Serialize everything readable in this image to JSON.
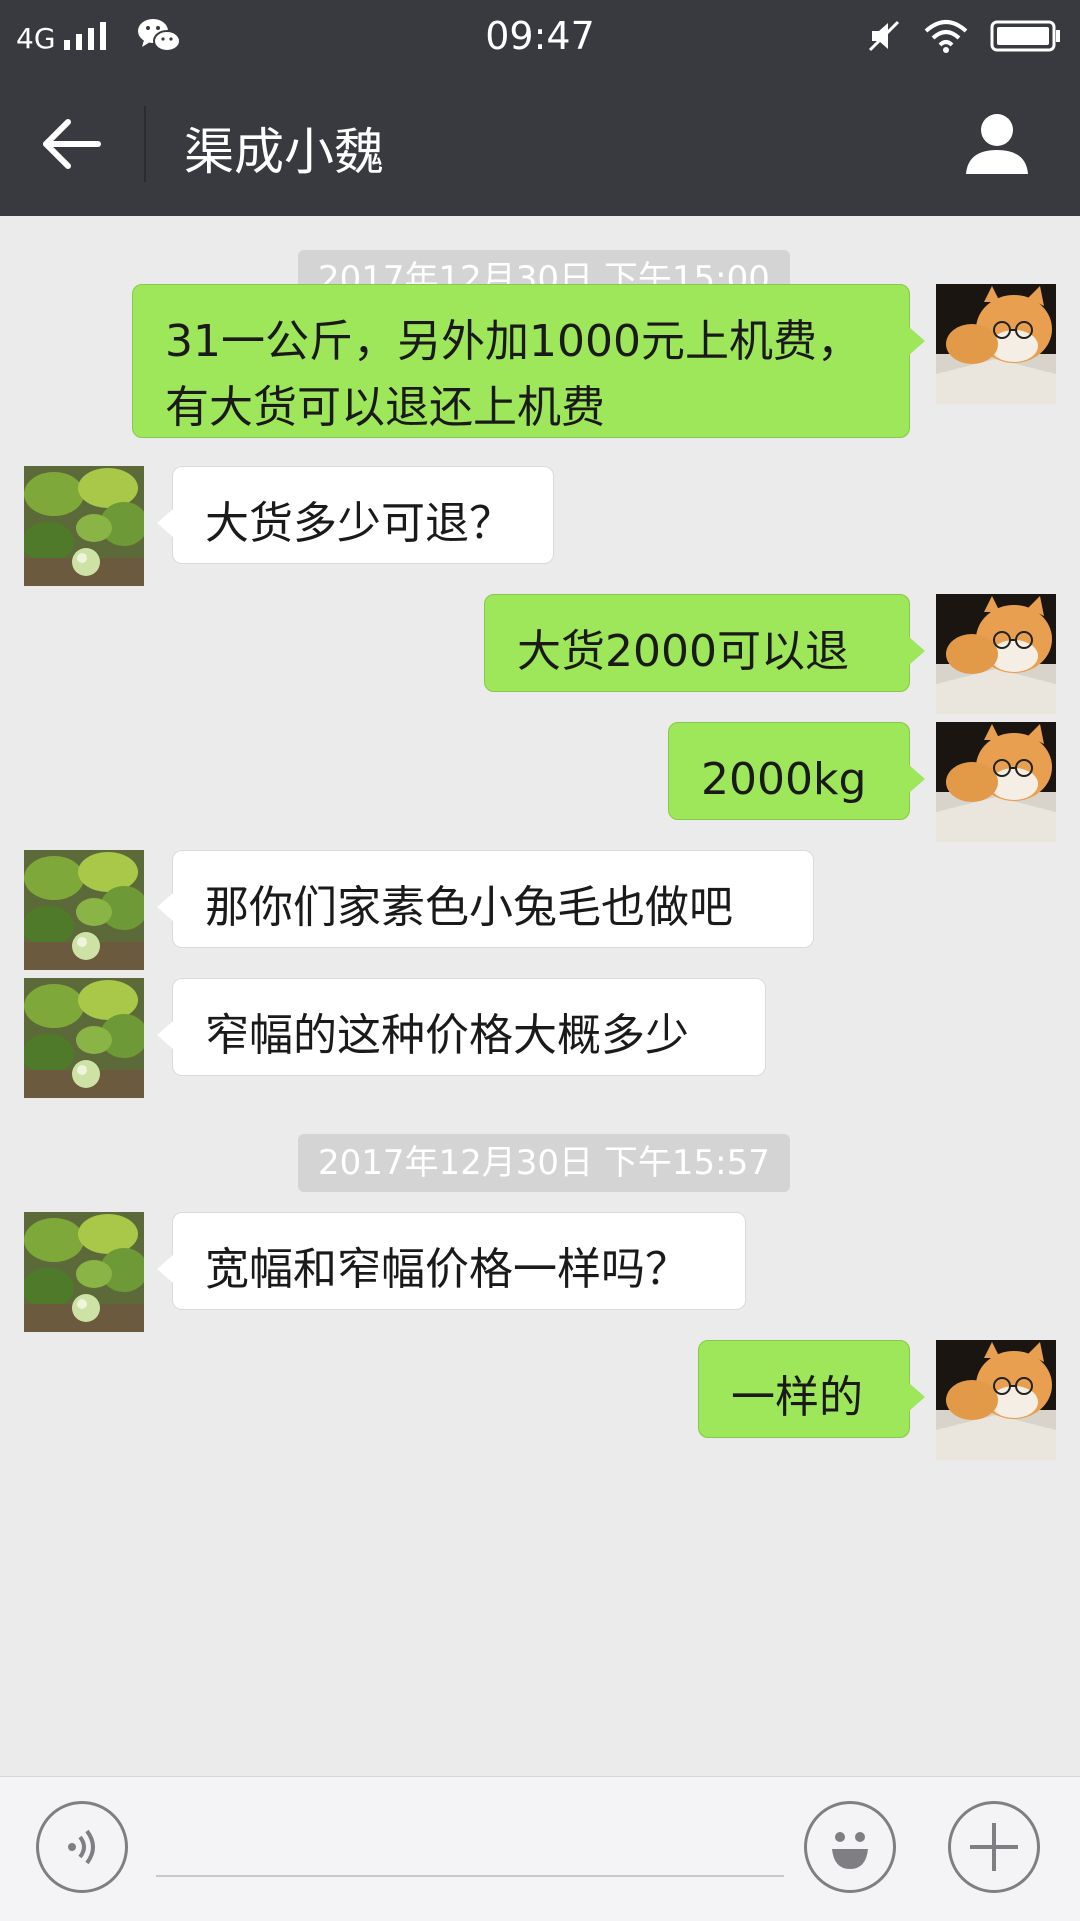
{
  "status_bar": {
    "network": "4G",
    "time": "09:47"
  },
  "header": {
    "title": "渠成小魏"
  },
  "messages": [
    {
      "type": "timestamp",
      "text": "2017年12月30日 下午15:00"
    },
    {
      "type": "sent",
      "lines": [
        "31一公斤，另外加1000元上机费，",
        "有大货可以退还上机费"
      ]
    },
    {
      "type": "received",
      "lines": [
        "大货多少可退？"
      ]
    },
    {
      "type": "sent",
      "lines": [
        "大货2000可以退"
      ]
    },
    {
      "type": "sent",
      "lines": [
        "2000kg"
      ]
    },
    {
      "type": "received",
      "lines": [
        "那你们家素色小兔毛也做吧"
      ]
    },
    {
      "type": "received",
      "lines": [
        "窄幅的这种价格大概多少"
      ]
    },
    {
      "type": "timestamp",
      "text": "2017年12月30日 下午15:57"
    },
    {
      "type": "received",
      "lines": [
        "宽幅和窄幅价格一样吗？"
      ]
    },
    {
      "type": "sent",
      "lines": [
        "一样的"
      ]
    }
  ],
  "input_bar": {
    "voice_icon": "voice-icon",
    "emoji_icon": "emoji-icon",
    "plus_icon": "plus-icon",
    "value": ""
  },
  "colors": {
    "header_bg": "#393a3f",
    "chat_bg": "#ebebeb",
    "sent_bubble": "#9ee65a",
    "received_bubble": "#ffffff"
  }
}
